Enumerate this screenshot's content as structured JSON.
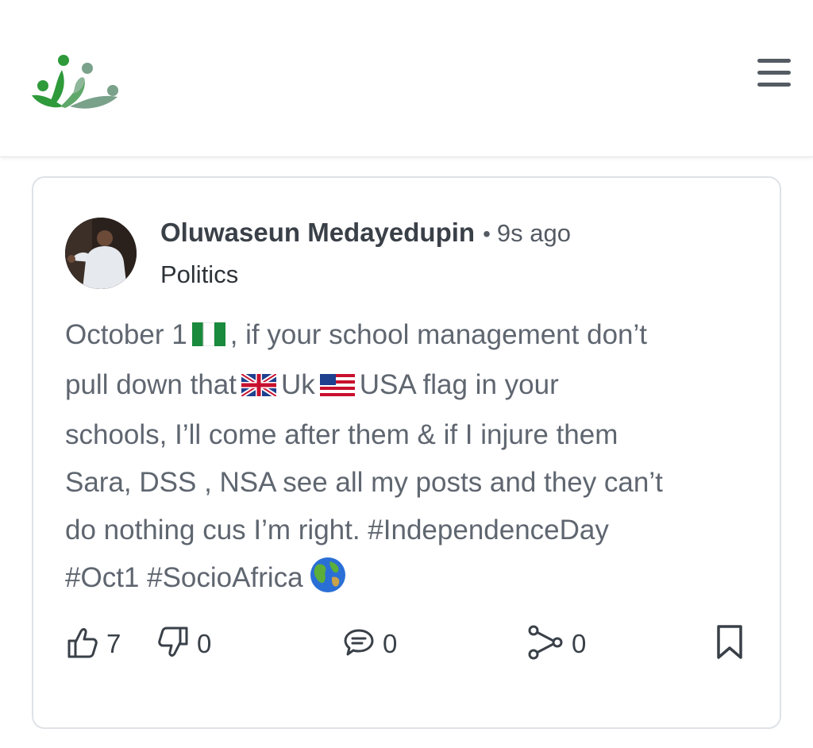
{
  "header": {
    "logo_icon": "community-people-logo",
    "menu_icon": "hamburger-menu-icon",
    "brand_green": "#3a9a3a"
  },
  "post": {
    "author": "Oluwaseun Medayedupin",
    "separator": "•",
    "time_ago": "9s ago",
    "category": "Politics",
    "lines": [
      {
        "text": "October 1",
        "after_flag": ", if your school management don’t",
        "flag": "nigeria-flag"
      },
      {
        "before": "pull down that",
        "mid": "Uk",
        "after": "USA flag in your"
      },
      {
        "text": "schools, I’ll come after them & if I injure them"
      },
      {
        "text": "Sara, DSS , NSA see all my posts and they can’t"
      },
      {
        "text": "do nothing cus I’m right. #IndependenceDay"
      },
      {
        "text": "#Oct1 #SocioAfrica"
      }
    ],
    "actions": {
      "likes": "7",
      "dislikes": "0",
      "comments": "0",
      "shares": "0"
    }
  }
}
